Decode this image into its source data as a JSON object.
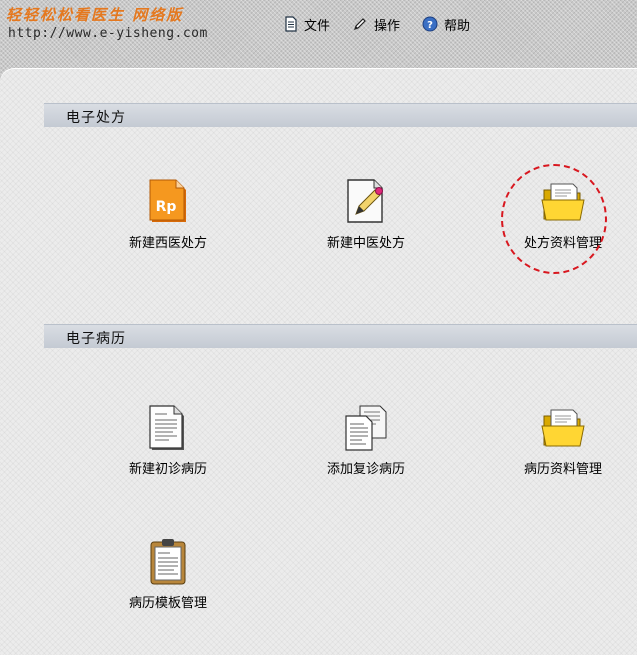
{
  "logo": {
    "title": "轻轻松松看医生 网络版",
    "url": "http://www.e-yisheng.com"
  },
  "menu": {
    "file": "文件",
    "operate": "操作",
    "help": "帮助"
  },
  "sections": {
    "prescription": {
      "title": "电子处方",
      "items": [
        {
          "label": "新建西医处方",
          "icon": "rp-prescription-icon"
        },
        {
          "label": "新建中医处方",
          "icon": "pencil-document-icon"
        },
        {
          "label": "处方资料管理",
          "icon": "open-folder-icon"
        }
      ]
    },
    "record": {
      "title": "电子病历",
      "items": [
        {
          "label": "新建初诊病历",
          "icon": "document-icon"
        },
        {
          "label": "添加复诊病历",
          "icon": "documents-icon"
        },
        {
          "label": "病历资料管理",
          "icon": "open-folder-icon"
        },
        {
          "label": "病历模板管理",
          "icon": "clipboard-icon"
        }
      ]
    }
  },
  "colors": {
    "logo": "#e4781f",
    "highlight": "#d8171f",
    "rp": "#f08a12"
  }
}
